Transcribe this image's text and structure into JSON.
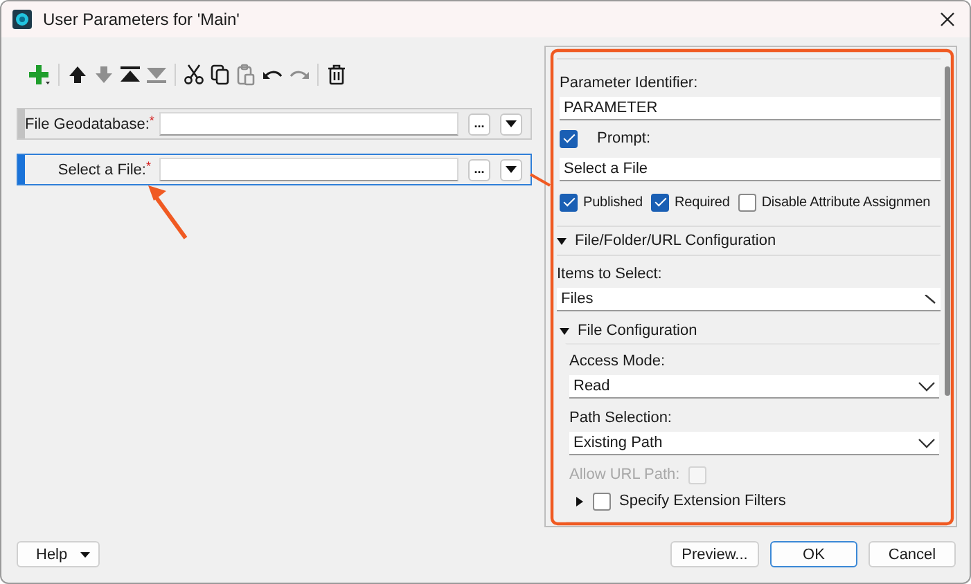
{
  "window": {
    "title": "User Parameters for 'Main'"
  },
  "toolbar": [
    [
      {
        "kind": "add",
        "disabled": false
      }
    ],
    [
      {
        "kind": "up",
        "disabled": false
      },
      {
        "kind": "down",
        "disabled": true
      },
      {
        "kind": "top",
        "disabled": false
      },
      {
        "kind": "bottom",
        "disabled": true
      }
    ],
    [
      {
        "kind": "cut",
        "disabled": false
      },
      {
        "kind": "copy",
        "disabled": false
      },
      {
        "kind": "paste",
        "disabled": true
      },
      {
        "kind": "undo",
        "disabled": false
      },
      {
        "kind": "redo",
        "disabled": true
      }
    ],
    [
      {
        "kind": "delete",
        "disabled": false
      }
    ]
  ],
  "parameters": [
    {
      "label": "File Geodatabase:",
      "required_mark": "*",
      "browse": "...",
      "selected": false
    },
    {
      "label": "Select a File:",
      "required_mark": "*",
      "browse": "...",
      "selected": true
    }
  ],
  "editor": {
    "identifier_label": "Parameter Identifier:",
    "identifier": "PARAMETER",
    "prompt_label": "Prompt:",
    "prompt_checked": true,
    "prompt": "Select a File",
    "options": [
      {
        "label": "Published",
        "checked": true
      },
      {
        "label": "Required",
        "checked": true
      },
      {
        "label": "Disable Attribute Assignmen",
        "checked": false
      }
    ],
    "config": {
      "title": "File/Folder/URL Configuration",
      "expanded": true,
      "items_label": "Items to Select:",
      "items_value": "Files",
      "file_config": {
        "title": "File Configuration",
        "expanded": true,
        "access_label": "Access Mode:",
        "access_value": "Read",
        "path_label": "Path Selection:",
        "path_value": "Existing Path",
        "allow_url_label": "Allow URL Path:",
        "allow_url_checked": false,
        "allow_url_disabled": true,
        "filters": {
          "label": "Specify Extension Filters",
          "checked": false,
          "expanded": false
        }
      }
    }
  },
  "footer": {
    "help": "Help",
    "buttons": [
      {
        "label": "Preview...",
        "default": false
      },
      {
        "label": "OK",
        "default": true
      },
      {
        "label": "Cancel",
        "default": false
      }
    ]
  }
}
